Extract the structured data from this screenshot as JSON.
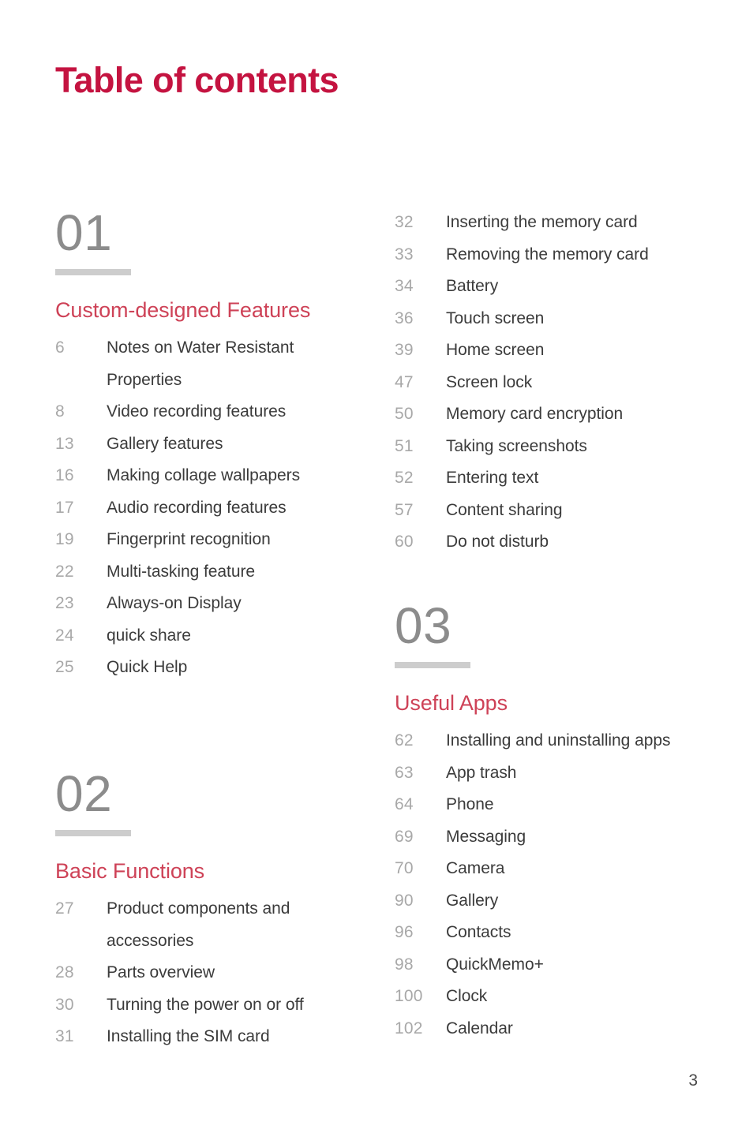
{
  "document": {
    "title": "Table of contents",
    "folio": "3",
    "colors": {
      "title_red": "#C41340",
      "heading_rose": "#CE4257",
      "section_number_gray": "#8C8C8C",
      "rule_gray": "#CDCDCD",
      "page_number_gray": "#A8A8A8",
      "entry_text": "#3B3B3B"
    }
  },
  "columns": {
    "left": {
      "sections": [
        {
          "number": "01",
          "heading": "Custom-designed Features",
          "entries": [
            {
              "page": "6",
              "label": "Notes on Water Resistant Properties"
            },
            {
              "page": "8",
              "label": "Video recording features"
            },
            {
              "page": "13",
              "label": "Gallery features"
            },
            {
              "page": "16",
              "label": "Making collage wallpapers"
            },
            {
              "page": "17",
              "label": "Audio recording features"
            },
            {
              "page": "19",
              "label": "Fingerprint recognition"
            },
            {
              "page": "22",
              "label": "Multi-tasking feature"
            },
            {
              "page": "23",
              "label": "Always-on Display"
            },
            {
              "page": "24",
              "label": "quick share"
            },
            {
              "page": "25",
              "label": "Quick Help"
            }
          ]
        },
        {
          "number": "02",
          "heading": "Basic Functions",
          "entries": [
            {
              "page": "27",
              "label": "Product components and accessories"
            },
            {
              "page": "28",
              "label": "Parts overview"
            },
            {
              "page": "30",
              "label": "Turning the power on or off"
            },
            {
              "page": "31",
              "label": "Installing the SIM card"
            }
          ]
        }
      ]
    },
    "right": {
      "continuation": {
        "entries": [
          {
            "page": "32",
            "label": "Inserting the memory card"
          },
          {
            "page": "33",
            "label": "Removing the memory card"
          },
          {
            "page": "34",
            "label": "Battery"
          },
          {
            "page": "36",
            "label": "Touch screen"
          },
          {
            "page": "39",
            "label": "Home screen"
          },
          {
            "page": "47",
            "label": "Screen lock"
          },
          {
            "page": "50",
            "label": "Memory card encryption"
          },
          {
            "page": "51",
            "label": "Taking screenshots"
          },
          {
            "page": "52",
            "label": "Entering text"
          },
          {
            "page": "57",
            "label": "Content sharing"
          },
          {
            "page": "60",
            "label": "Do not disturb"
          }
        ]
      },
      "sections": [
        {
          "number": "03",
          "heading": "Useful Apps",
          "entries": [
            {
              "page": "62",
              "label": "Installing and uninstalling apps"
            },
            {
              "page": "63",
              "label": "App trash"
            },
            {
              "page": "64",
              "label": "Phone"
            },
            {
              "page": "69",
              "label": "Messaging"
            },
            {
              "page": "70",
              "label": "Camera"
            },
            {
              "page": "90",
              "label": "Gallery"
            },
            {
              "page": "96",
              "label": "Contacts"
            },
            {
              "page": "98",
              "label": "QuickMemo+"
            },
            {
              "page": "100",
              "label": "Clock"
            },
            {
              "page": "102",
              "label": "Calendar"
            }
          ]
        }
      ]
    }
  }
}
